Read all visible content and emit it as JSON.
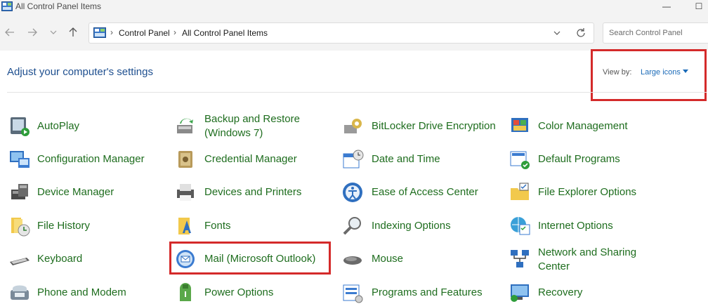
{
  "window": {
    "title": "All Control Panel Items",
    "minimize": "—",
    "maximize": "☐"
  },
  "nav": {
    "breadcrumb_sep": "›",
    "crumbs": [
      "Control Panel",
      "All Control Panel Items"
    ],
    "search_placeholder": "Search Control Panel"
  },
  "header": {
    "title": "Adjust your computer's settings",
    "view_by_label": "View by:",
    "view_by_value": "Large icons"
  },
  "items": {
    "autoplay": "AutoPlay",
    "backup": "Backup and Restore (Windows 7)",
    "bitlocker": "BitLocker Drive Encryption",
    "color_mgmt": "Color Management",
    "config_mgr": "Configuration Manager",
    "credential_mgr": "Credential Manager",
    "date_time": "Date and Time",
    "default_programs": "Default Programs",
    "device_mgr": "Device Manager",
    "devices_printers": "Devices and Printers",
    "ease_access": "Ease of Access Center",
    "file_explorer_opts": "File Explorer Options",
    "file_history": "File History",
    "fonts": "Fonts",
    "indexing": "Indexing Options",
    "internet_opts": "Internet Options",
    "keyboard": "Keyboard",
    "mail": "Mail (Microsoft Outlook)",
    "mouse": "Mouse",
    "network_sharing": "Network and Sharing Center",
    "phone_modem": "Phone and Modem",
    "power": "Power Options",
    "programs_features": "Programs and Features",
    "recovery": "Recovery"
  },
  "colors": {
    "link_green": "#1e6d1e",
    "heading_blue": "#1e4f8f",
    "highlight_red": "#d42a2a"
  },
  "icons": {
    "autoplay": "autoplay-icon",
    "backup": "backup-restore-icon",
    "bitlocker": "bitlocker-key-icon",
    "color_mgmt": "color-management-icon",
    "config_mgr": "configuration-manager-icon",
    "credential_mgr": "credential-vault-icon",
    "date_time": "calendar-clock-icon",
    "default_programs": "default-programs-icon",
    "device_mgr": "device-manager-icon",
    "devices_printers": "printer-icon",
    "ease_access": "ease-of-access-icon",
    "file_explorer_opts": "folder-options-icon",
    "file_history": "file-history-icon",
    "fonts": "fonts-folder-icon",
    "indexing": "indexing-magnifier-icon",
    "internet_opts": "internet-options-icon",
    "keyboard": "keyboard-icon",
    "mail": "mail-outlook-icon",
    "mouse": "mouse-icon",
    "network_sharing": "network-sharing-icon",
    "phone_modem": "phone-modem-icon",
    "power": "power-options-icon",
    "programs_features": "programs-features-icon",
    "recovery": "recovery-monitor-icon"
  }
}
